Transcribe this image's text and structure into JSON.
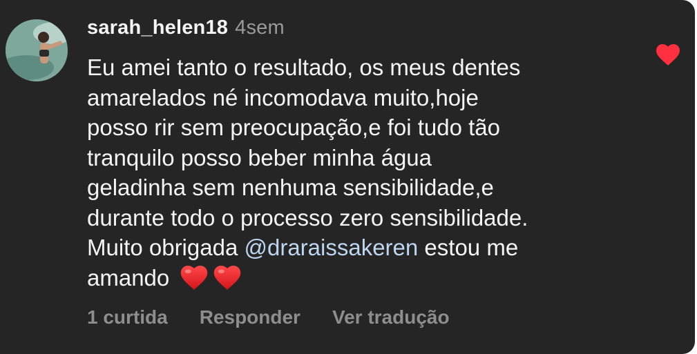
{
  "comment": {
    "username": "sarah_helen18",
    "time_ago": "4sem",
    "lines": [
      "Eu amei tanto o resultado, os meus dentes",
      "amarelados né incomodava muito,hoje",
      "posso rir sem preocupação,e foi tudo tão",
      "tranquilo posso beber minha água",
      "geladinha sem nenhuma sensibilidade,e",
      "durante todo o processo zero sensibilidade."
    ],
    "line7_prefix": "Muito obrigada ",
    "mention": "@draraissakeren",
    "line7_suffix": " estou me",
    "line8_text": "amando",
    "trailing_emojis": [
      "red-heart-emoji",
      "red-heart-emoji"
    ],
    "liked": true
  },
  "actions": {
    "likes_label": "1 curtida",
    "reply_label": "Responder",
    "translate_label": "Ver tradução"
  },
  "colors": {
    "background": "#252525",
    "text": "#f5f5f5",
    "muted": "#8e8e8e",
    "mention": "#bcd6ef",
    "heart": "#ff3040"
  }
}
